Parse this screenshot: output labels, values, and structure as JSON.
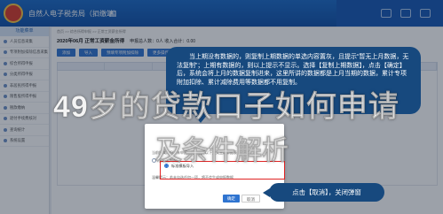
{
  "header": {
    "app_title": "自然人电子税务局（扣缴端）",
    "logo_icon": "tax-emblem-icon",
    "nav_icons": [
      "home-icon",
      "document-icon"
    ]
  },
  "sidebar": {
    "heading": "功能菜单",
    "items": [
      "人员信息采集",
      "专项附加扣除信息采集",
      "综合所得申报",
      "分类所得申报",
      "非居民所得申报",
      "限售股所得申报",
      "税款缴纳",
      "退付手续费核对",
      "查询统计",
      "系统设置"
    ]
  },
  "main": {
    "breadcrumb": "首页 >> 综合所得申报 >> 正常工资薪金所得",
    "title": "2020年06月 正常工资薪金所得",
    "title_meta": "申报总人数：0人  收入合计：0.00",
    "buttons": [
      "添加",
      "导入",
      "预填专项附加扣除",
      "更多操作"
    ]
  },
  "dialog": {
    "line1": "当前所属月份尚未申报，可以选择以下方式生成申报表",
    "line2": "复制上期数据",
    "option_selected": "标准模板导入",
    "line3": "温馨提示：若未勾选任何一项，将不会生成申报数据",
    "ok_label": "确定",
    "cancel_label": "取消"
  },
  "tooltip": {
    "text": "当上期没有数据的，则复制上期数据的单选内容置灰，且提示“暂无上月数据，无法复制”；上期有数据的，则以上提示不显示。选择【复制上期数据】，点击【确定】后，系统会将上月的数据复制进来，这里所讲的数据都是上月当期的数据，累计专项附加扣除、累计减除费用等数据都不用复制。"
  },
  "tooltip2": {
    "text": "点击【取消】，关闭弹窗"
  },
  "watermark": {
    "line1": "49岁的贷款口子如何申请",
    "line2": "及条件解析"
  }
}
